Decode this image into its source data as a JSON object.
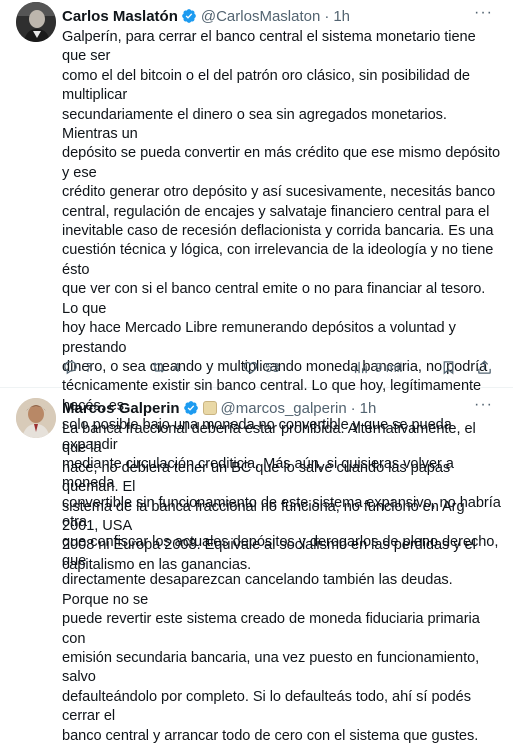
{
  "tweets": [
    {
      "name": "Carlos Maslatón",
      "handle": "@CarlosMaslaton",
      "time": "1h",
      "text": "Galperín, para cerrar el banco central el sistema monetario tiene que ser\ncomo el del bitcoin o el del patrón oro clásico, sin posibilidad de multiplicar\nsecundariamente el dinero o sea sin agregados monetarios. Mientras un\ndepósito se pueda convertir en más crédito que ese mismo depósito y ese\ncrédito generar otro depósito y así sucesivamente, necesitás banco\ncentral, regulación de encajes y salvataje financiero central para el\ninevitable caso de recesión deflacionista y corrida bancaria. Es una\ncuestión técnica y lógica, con irrelevancia de la ideología y no tiene ésto\nque ver con si el banco central emite o no para financiar al tesoro. Lo que\nhoy hace Mercado Libre remunerando depósitos a voluntad y prestando\ndinero, o sea creando y multiplicando moneda bancaria, no podría\ntécnicamente existir sin banco central. Lo que hoy, legítimamente hacés, es\nsolo posible bajo una moneda no convertible y que se pueda expandir\nmediante circulación crediticia. Más aún, si quisieras volver a moneda\nconvertible sin funcionamiento de este sistema expansivo, no habría otra\nque confiscar los actuales depósitos y derogarlos de pleno derecho, que\ndirectamente desaparezcan cancelando también las deudas. Porque no se\npuede revertir este sistema creado de moneda fiduciaria primaria con\nemisión secundaria bancaria, una vez puesto en funcionamiento, salvo\ndefaulteándolo por completo. Si lo defaulteás todo, ahí sí podés cerrar el\nbanco central y arrancar todo de cero con el sistema que gustes.",
      "replies": "7",
      "retweets": "4",
      "likes": "53",
      "views": "9 mil"
    },
    {
      "name": "Marcos Galperin",
      "handle": "@marcos_galperin",
      "time": "1h",
      "text": "La banca fraccional debería estar prohibida. Alternativamente, el que la\nhace, no debiera tener un BC que lo salve cuando las papas queman. El\nsistema de la banca fraccional no funciona, no funcionó en Arg 2001, USA\n2008 ni Europa 2008. Equivale al socialismo en las perdidas y el\ncapitalismo en las ganancias."
    }
  ],
  "more_label": "···",
  "dot": "·",
  "colors": {
    "verified": "#1d9bf0",
    "muted": "#536471",
    "text": "#0f1419"
  }
}
